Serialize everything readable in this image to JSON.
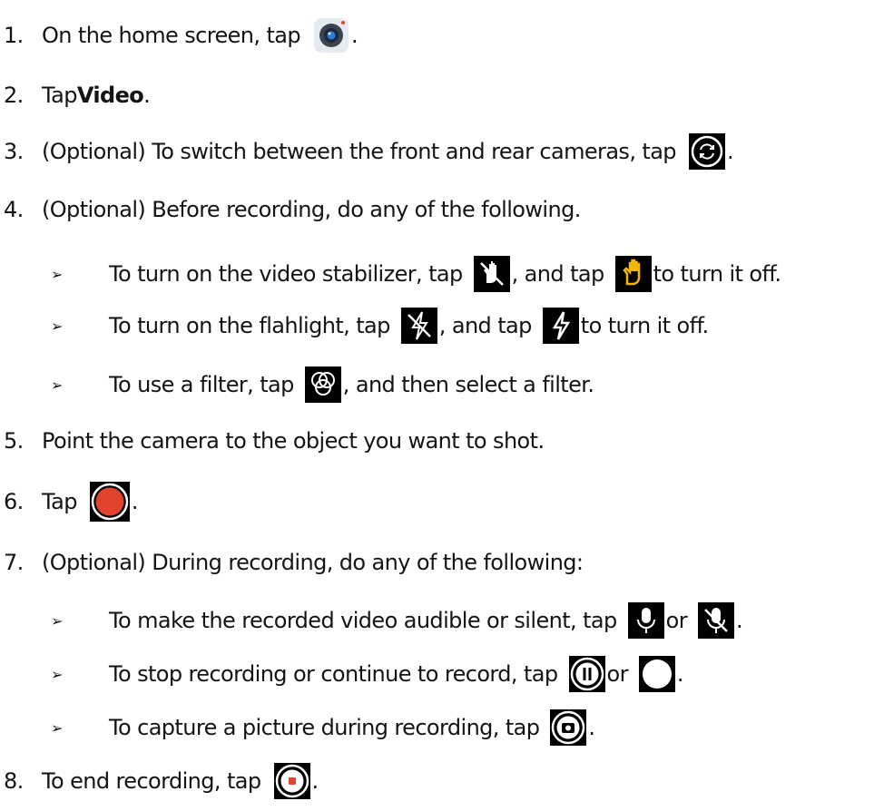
{
  "steps": [
    {
      "num": "1.",
      "pre": "On the home screen, tap",
      "post": ".",
      "icon": "camera-app-icon"
    },
    {
      "num": "2.",
      "pre": "Tap ",
      "bold": "Video",
      "post": "."
    },
    {
      "num": "3.",
      "pre": "(Optional) To switch between the front and rear cameras, tap",
      "post": ".",
      "icon": "switch-camera-icon"
    },
    {
      "num": "4.",
      "text": "(Optional) Before recording, do any of the following.",
      "bullets": [
        {
          "marker": "➢",
          "pre": "To turn on the video stabilizer, tap",
          "mid": ", and tap",
          "post": " to turn it off.",
          "icons": [
            "stabilizer-off-icon",
            "stabilizer-on-icon"
          ]
        },
        {
          "marker": "➢",
          "pre": "To turn on the flahlight, tap",
          "mid": ", and tap",
          "post": " to turn it off.",
          "icons": [
            "flashlight-off-icon",
            "flashlight-on-icon"
          ]
        },
        {
          "marker": "➢",
          "pre": "To use a filter, tap",
          "post": ", and then select a filter.",
          "icons": [
            "filter-icon"
          ]
        }
      ]
    },
    {
      "num": "5.",
      "text": "Point the camera to the object you want to shot."
    },
    {
      "num": "6.",
      "pre": "Tap",
      "post": ".",
      "icon": "record-button-icon"
    },
    {
      "num": "7.",
      "text": "(Optional) During recording, do any of the following:",
      "bullets": [
        {
          "marker": "➢",
          "pre": "To make the recorded video audible or silent, tap",
          "mid": " or ",
          "post": ".",
          "icons": [
            "microphone-icon",
            "microphone-muted-icon"
          ]
        },
        {
          "marker": "➢",
          "pre": "To stop recording or continue to record, tap",
          "mid": " or ",
          "post": ".",
          "icons": [
            "pause-icon",
            "resume-icon"
          ]
        },
        {
          "marker": "➢",
          "pre": "To capture a picture during recording, tap",
          "post": ".",
          "icons": [
            "snapshot-icon"
          ]
        }
      ]
    },
    {
      "num": "8.",
      "pre": "To end recording, tap",
      "post": ".",
      "icon": "stop-record-icon"
    }
  ],
  "colors": {
    "record_red": "#e0442d",
    "stabilizer_on": "#f2b705",
    "text": "#141414"
  }
}
